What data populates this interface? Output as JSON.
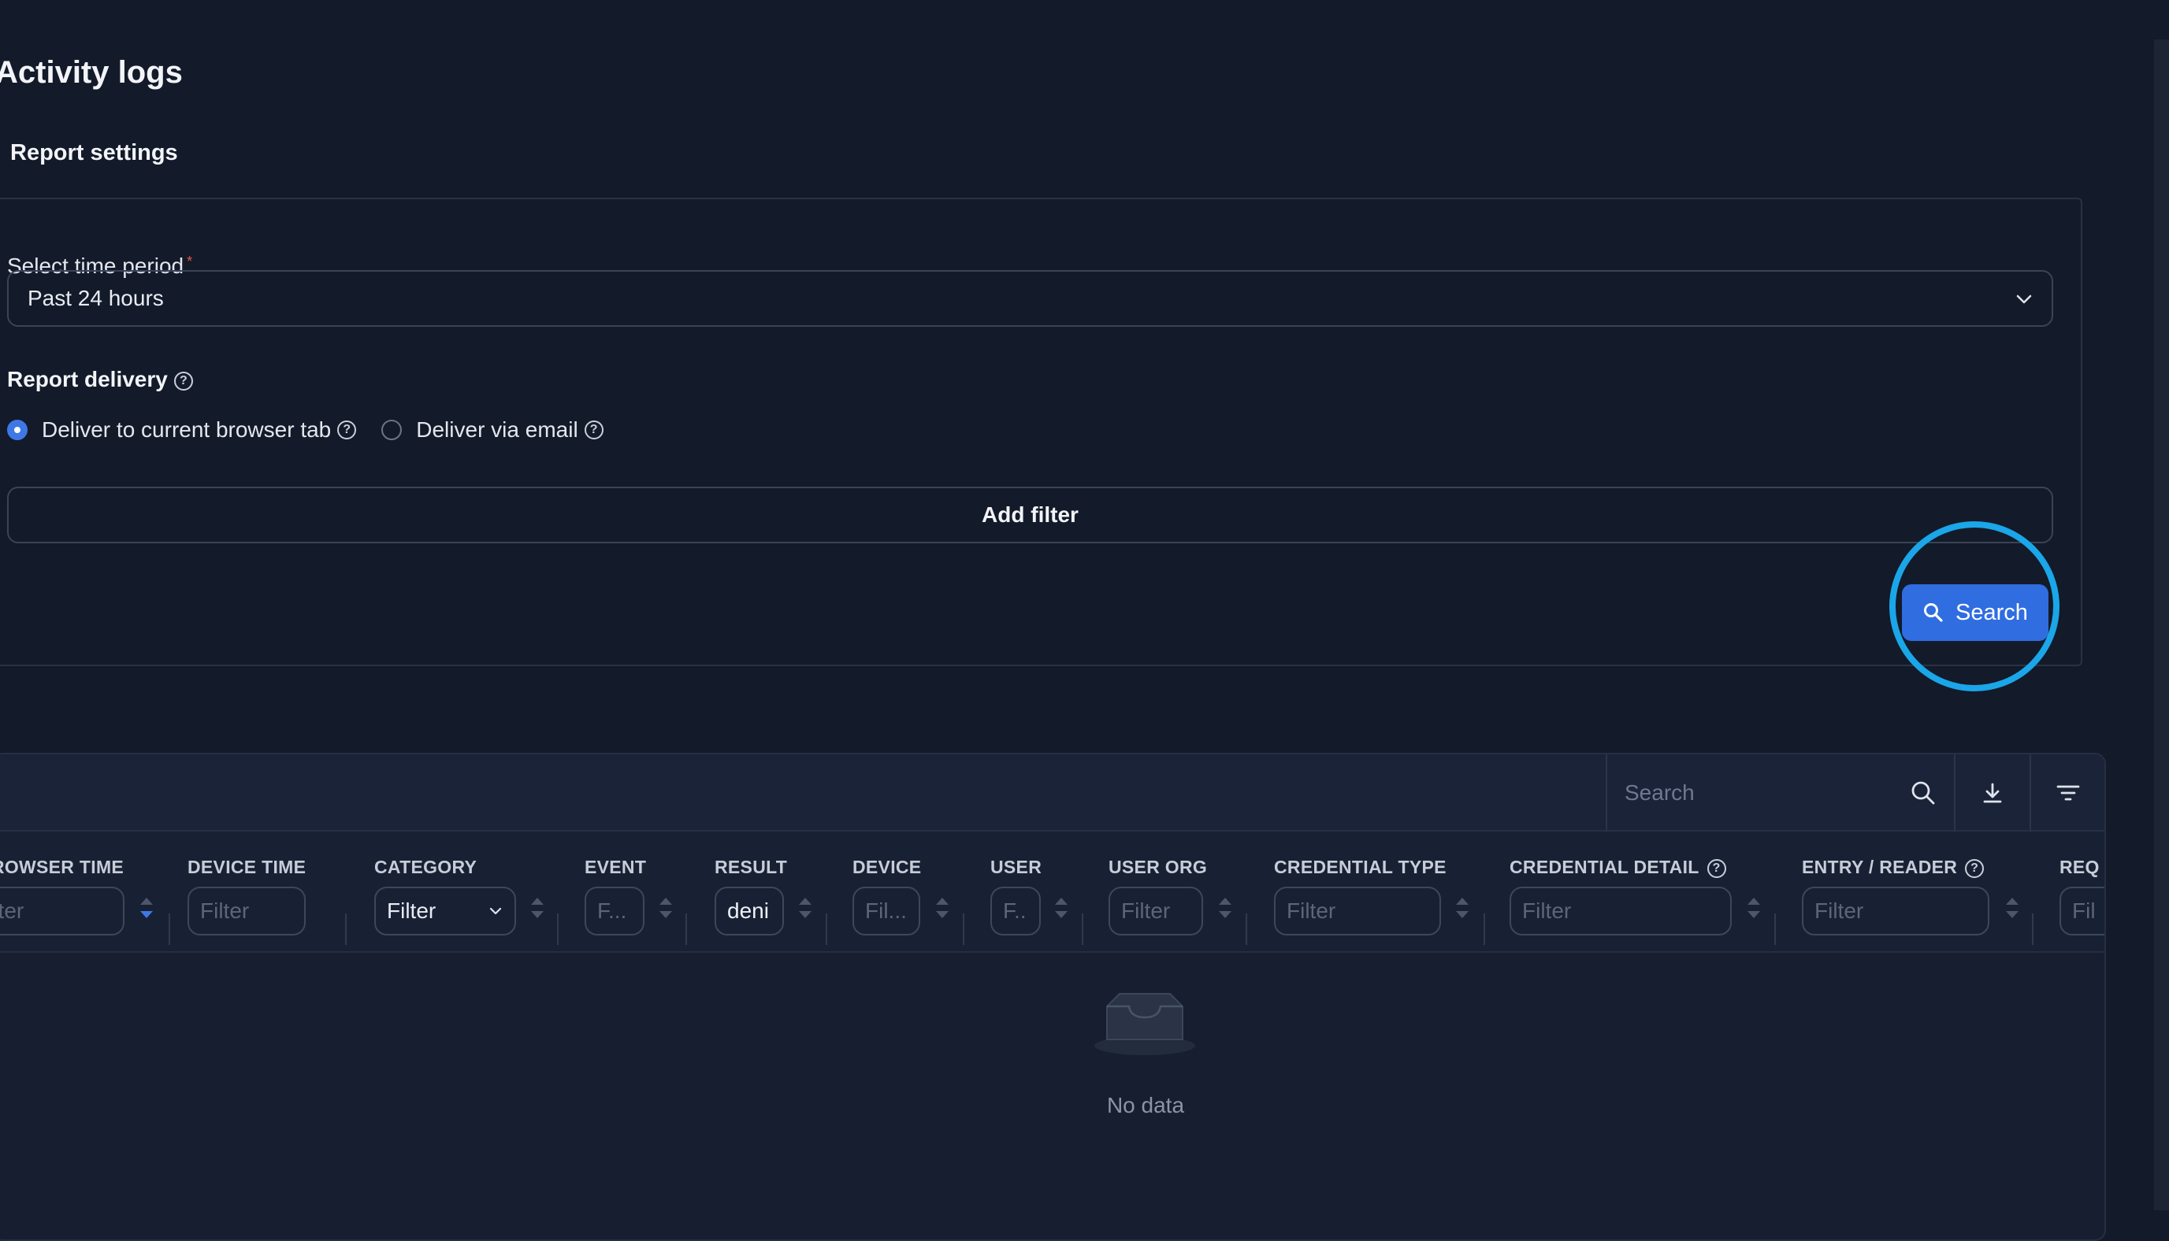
{
  "page": {
    "title": "Activity logs"
  },
  "report_settings": {
    "section_title": "Report settings",
    "time_period": {
      "label": "Select time period",
      "required_mark": "*",
      "value": "Past 24 hours"
    },
    "delivery": {
      "label": "Report delivery",
      "options": [
        {
          "label": "Deliver to current browser tab",
          "selected": true
        },
        {
          "label": "Deliver via email",
          "selected": false
        }
      ]
    },
    "add_filter_label": "Add filter",
    "search_button_label": "Search"
  },
  "table": {
    "search_placeholder": "Search",
    "columns": [
      {
        "title": "BROWSER TIME",
        "filter": "Filter",
        "filter_kind": "placeholder"
      },
      {
        "title": "DEVICE TIME",
        "filter": "Filter",
        "filter_kind": "placeholder"
      },
      {
        "title": "CATEGORY",
        "filter": "Filter",
        "filter_kind": "select"
      },
      {
        "title": "EVENT",
        "filter": "F...",
        "filter_kind": "placeholder"
      },
      {
        "title": "RESULT",
        "filter": "deni",
        "filter_kind": "value"
      },
      {
        "title": "DEVICE",
        "filter": "Fil...",
        "filter_kind": "placeholder"
      },
      {
        "title": "USER",
        "filter": "F..",
        "filter_kind": "placeholder"
      },
      {
        "title": "USER ORG",
        "filter": "Filter",
        "filter_kind": "placeholder"
      },
      {
        "title": "CREDENTIAL TYPE",
        "filter": "Filter",
        "filter_kind": "placeholder"
      },
      {
        "title": "CREDENTIAL DETAIL",
        "filter": "Filter",
        "filter_kind": "placeholder"
      },
      {
        "title": "ENTRY / READER",
        "filter": "Filter",
        "filter_kind": "placeholder"
      },
      {
        "title": "REQ",
        "filter": "Fil",
        "filter_kind": "placeholder"
      }
    ],
    "empty_text": "No data"
  },
  "colors": {
    "background": "#131a29",
    "accent": "#2f6de0",
    "highlight_ring": "#1aa6e8"
  }
}
